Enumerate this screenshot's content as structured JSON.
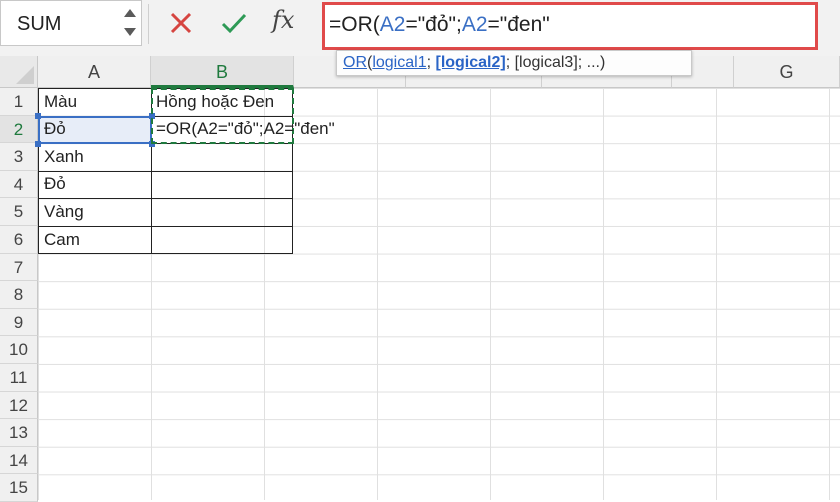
{
  "formula_bar": {
    "name_box": "SUM",
    "cancel_icon": "cross-icon",
    "enter_icon": "checkmark-icon",
    "fx_label": "fx",
    "formula_parts": [
      "=OR(",
      "A2",
      "=\"đỏ\";",
      "A2",
      "=\"đen\""
    ]
  },
  "tooltip": {
    "function": "OR",
    "open": "(",
    "arg1": "logical1",
    "sep1": "; ",
    "arg2": "[logical2]",
    "sep2": "; ",
    "arg3": "[logical3]; ...)"
  },
  "columns": [
    "A",
    "B",
    "G"
  ],
  "rows": [
    "1",
    "2",
    "3",
    "4",
    "5",
    "6",
    "7",
    "8",
    "9",
    "10",
    "11",
    "12",
    "13",
    "14",
    "15"
  ],
  "cells": {
    "A1": "Màu",
    "A2": "Đỏ",
    "A3": "Xanh",
    "A4": "Đỏ",
    "A5": "Vàng",
    "A6": "Cam",
    "B1": "Hồng hoặc Đen",
    "B2": "=OR(A2=\"đỏ\";A2=\"đen\""
  },
  "colors": {
    "reference": "#3a6fc4",
    "active_green": "#1f7a3e",
    "highlight_red": "#e04a4a"
  }
}
